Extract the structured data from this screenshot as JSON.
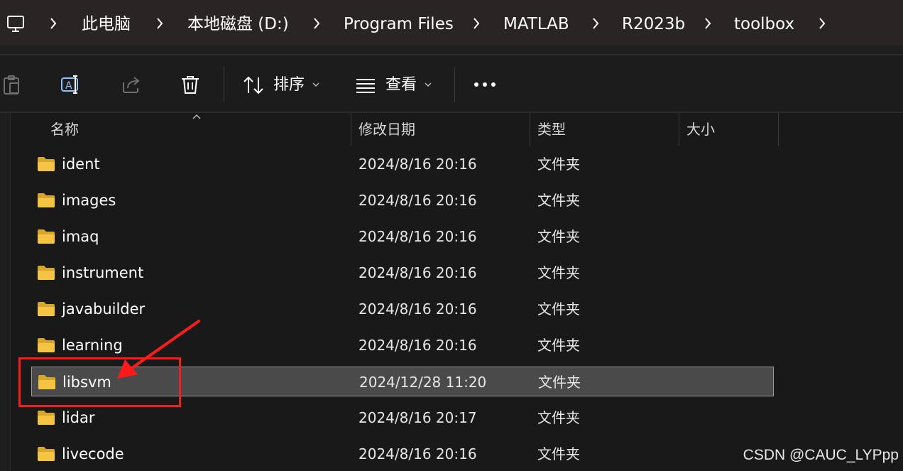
{
  "breadcrumb": {
    "items": [
      "此电脑",
      "本地磁盘 (D:)",
      "Program Files",
      "MATLAB",
      "R2023b",
      "toolbox"
    ]
  },
  "toolbar": {
    "icons": [
      "paste-icon",
      "rename-icon",
      "share-icon",
      "delete-icon"
    ],
    "sort_label": "排序",
    "view_label": "查看",
    "more_label": "•••"
  },
  "columns": {
    "name": "名称",
    "modified": "修改日期",
    "type": "类型",
    "size": "大小"
  },
  "files": [
    {
      "name": "ident",
      "modified": "2024/8/16 20:16",
      "type": "文件夹",
      "selected": false
    },
    {
      "name": "images",
      "modified": "2024/8/16 20:16",
      "type": "文件夹",
      "selected": false
    },
    {
      "name": "imaq",
      "modified": "2024/8/16 20:16",
      "type": "文件夹",
      "selected": false
    },
    {
      "name": "instrument",
      "modified": "2024/8/16 20:16",
      "type": "文件夹",
      "selected": false
    },
    {
      "name": "javabuilder",
      "modified": "2024/8/16 20:16",
      "type": "文件夹",
      "selected": false
    },
    {
      "name": "learning",
      "modified": "2024/8/16 20:16",
      "type": "文件夹",
      "selected": false
    },
    {
      "name": "libsvm",
      "modified": "2024/12/28 11:20",
      "type": "文件夹",
      "selected": true
    },
    {
      "name": "lidar",
      "modified": "2024/8/16 20:17",
      "type": "文件夹",
      "selected": false
    },
    {
      "name": "livecode",
      "modified": "2024/8/16 20:16",
      "type": "文件夹",
      "selected": false
    }
  ],
  "colors": {
    "annotation": "#ff1a1a",
    "folder": "#f5c443",
    "selection": "#4a4a4a"
  },
  "watermark": "CSDN @CAUC_LYPpp"
}
